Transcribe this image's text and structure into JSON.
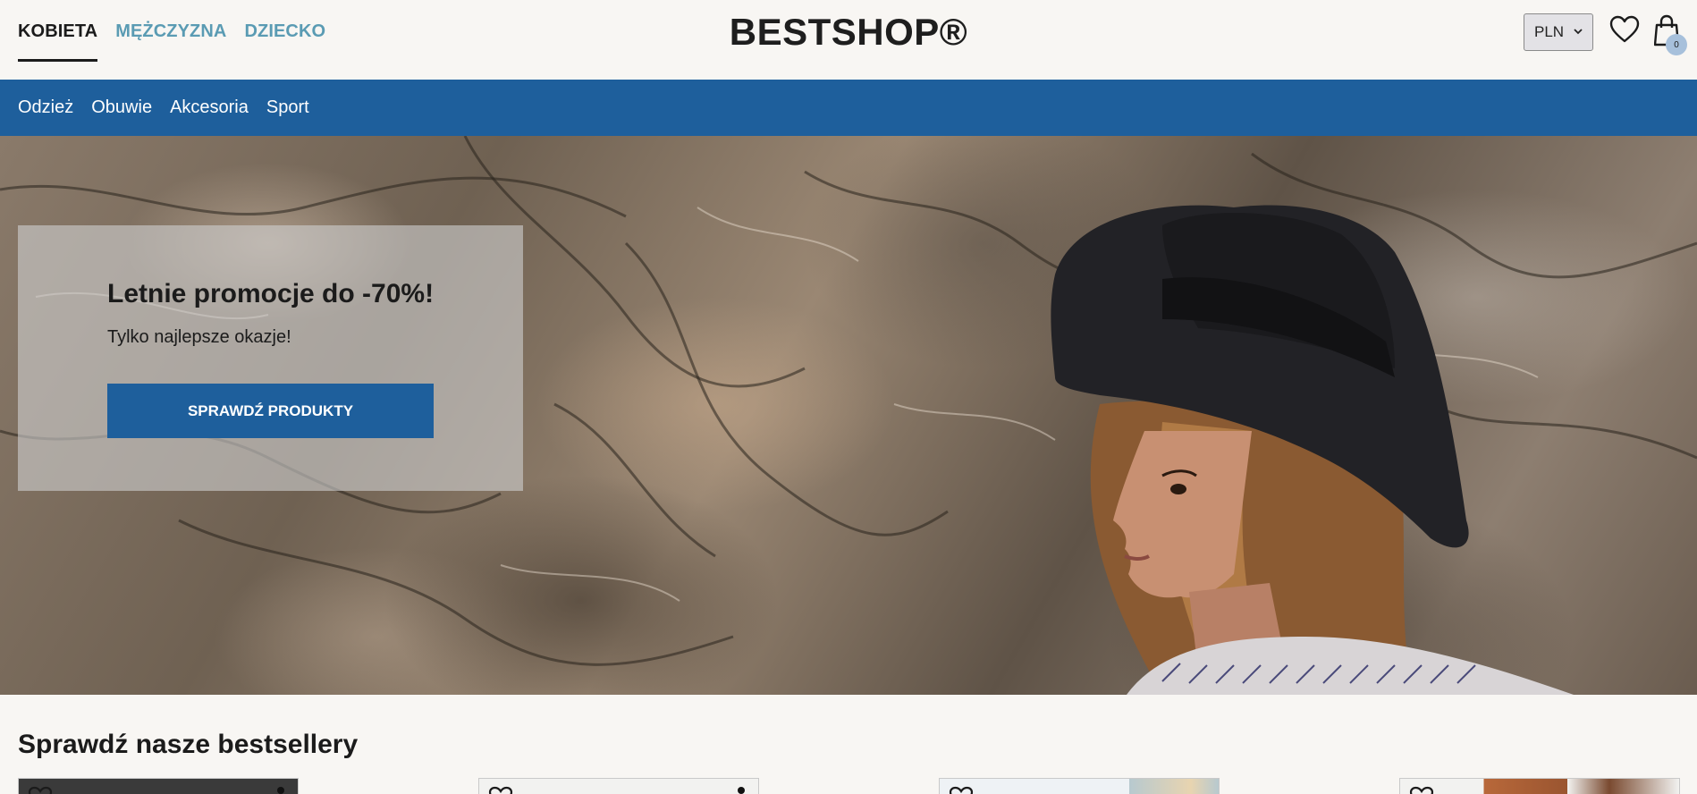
{
  "header": {
    "gender_tabs": [
      {
        "label": "KOBIETA",
        "active": true
      },
      {
        "label": "MĘŻCZYZNA",
        "active": false
      },
      {
        "label": "DZIECKO",
        "active": false
      }
    ],
    "logo": "BESTSHOP®",
    "currency": "PLN",
    "cart_count": "0",
    "icons": [
      "heart-icon",
      "shopping-bag-icon",
      "chevron-down-icon"
    ]
  },
  "categories": [
    "Odzież",
    "Obuwie",
    "Akcesoria",
    "Sport"
  ],
  "hero": {
    "title": "Letnie promocje do -70%!",
    "subtitle": "Tylko najlepsze okazje!",
    "cta": "SPRAWDŹ PRODUKTY"
  },
  "bestsellers": {
    "title": "Sprawdź nasze bestsellery"
  },
  "colors": {
    "brand_blue": "#1e5f9c",
    "inactive_tab": "#5a9bb3",
    "background": "#f8f6f3",
    "badge": "#a7c0db"
  }
}
